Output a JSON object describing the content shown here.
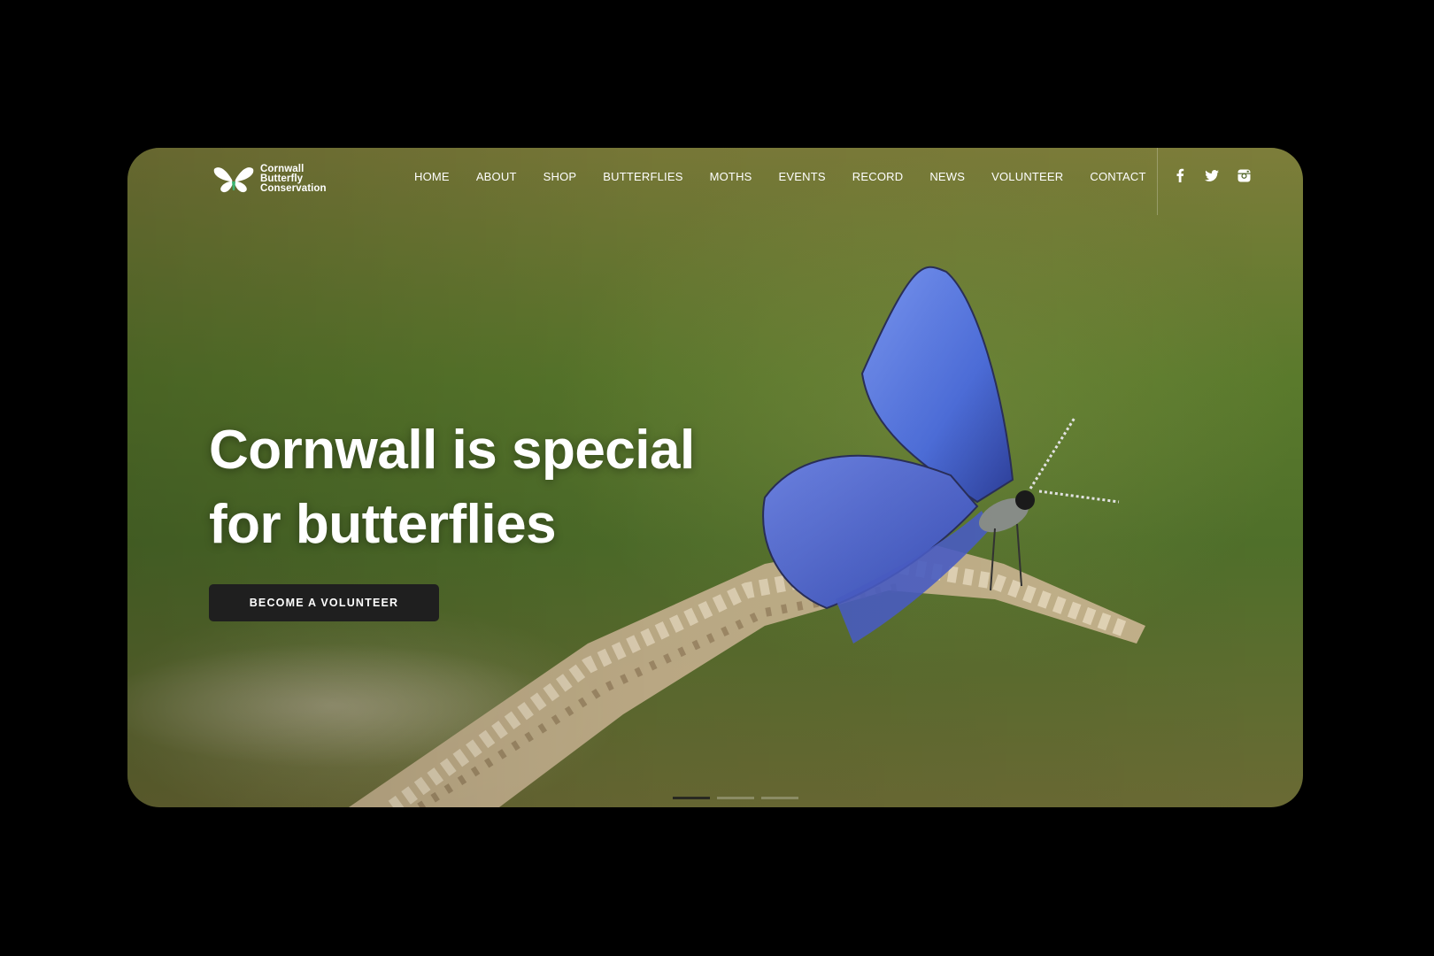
{
  "logo": {
    "lines": [
      "Cornwall",
      "Butterfly",
      "Conservation"
    ],
    "icon": "butterfly-icon"
  },
  "nav": {
    "items": [
      {
        "label": "HOME"
      },
      {
        "label": "ABOUT"
      },
      {
        "label": "SHOP"
      },
      {
        "label": "BUTTERFLIES"
      },
      {
        "label": "MOTHS"
      },
      {
        "label": "EVENTS"
      },
      {
        "label": "RECORD"
      },
      {
        "label": "NEWS"
      },
      {
        "label": "VOLUNTEER"
      },
      {
        "label": "CONTACT"
      }
    ]
  },
  "social": {
    "icons": [
      "facebook-icon",
      "twitter-icon",
      "instagram-icon"
    ]
  },
  "hero": {
    "headline_line1": "Cornwall is special",
    "headline_line2": "for butterflies",
    "cta_label": "BECOME A VOLUNTEER",
    "image": "blue-butterfly-on-grass-seed-head",
    "slides_total": 3,
    "active_slide": 1
  },
  "colors": {
    "background_frame": "#000000",
    "text": "#ffffff",
    "button_bg": "#1f1f1f",
    "butterfly_blue": "#5f84e6"
  }
}
